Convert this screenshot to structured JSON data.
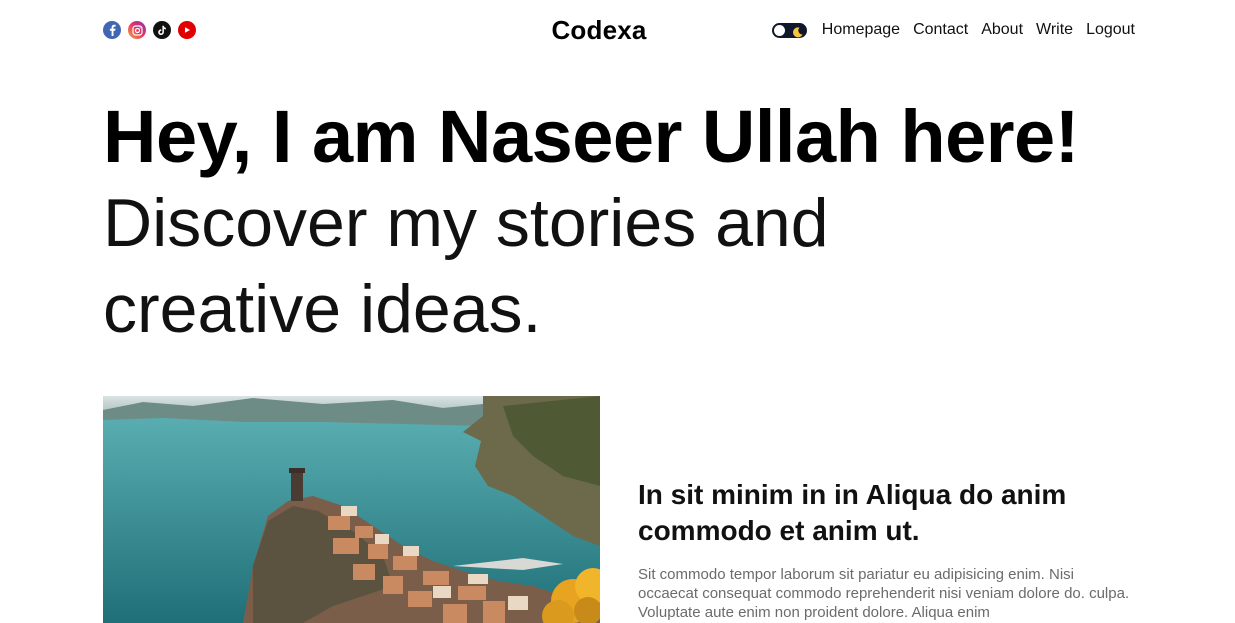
{
  "brand": {
    "logo": "Codexa"
  },
  "socials": [
    {
      "name": "facebook",
      "color": "#4267B2"
    },
    {
      "name": "instagram",
      "color": "#C13584"
    },
    {
      "name": "tiktok",
      "color": "#111111"
    },
    {
      "name": "youtube",
      "color": "#E10000"
    }
  ],
  "nav": {
    "theme_toggle": "dark-mode-toggle",
    "links": [
      "Homepage",
      "Contact",
      "About",
      "Write",
      "Logout"
    ]
  },
  "hero": {
    "greeting": "Hey, I am Naseer Ullah here!",
    "tagline": "Discover my stories and creative ideas."
  },
  "featured": {
    "image": "coastal-cliff-village-photo",
    "title": "In sit minim in in Aliqua do anim commodo et anim ut.",
    "description": "Sit commodo tempor laborum sit pariatur eu adipisicing enim. Nisi occaecat consequat commodo reprehenderit nisi veniam dolore do. culpa. Voluptate aute enim non proident dolore. Aliqua enim"
  }
}
